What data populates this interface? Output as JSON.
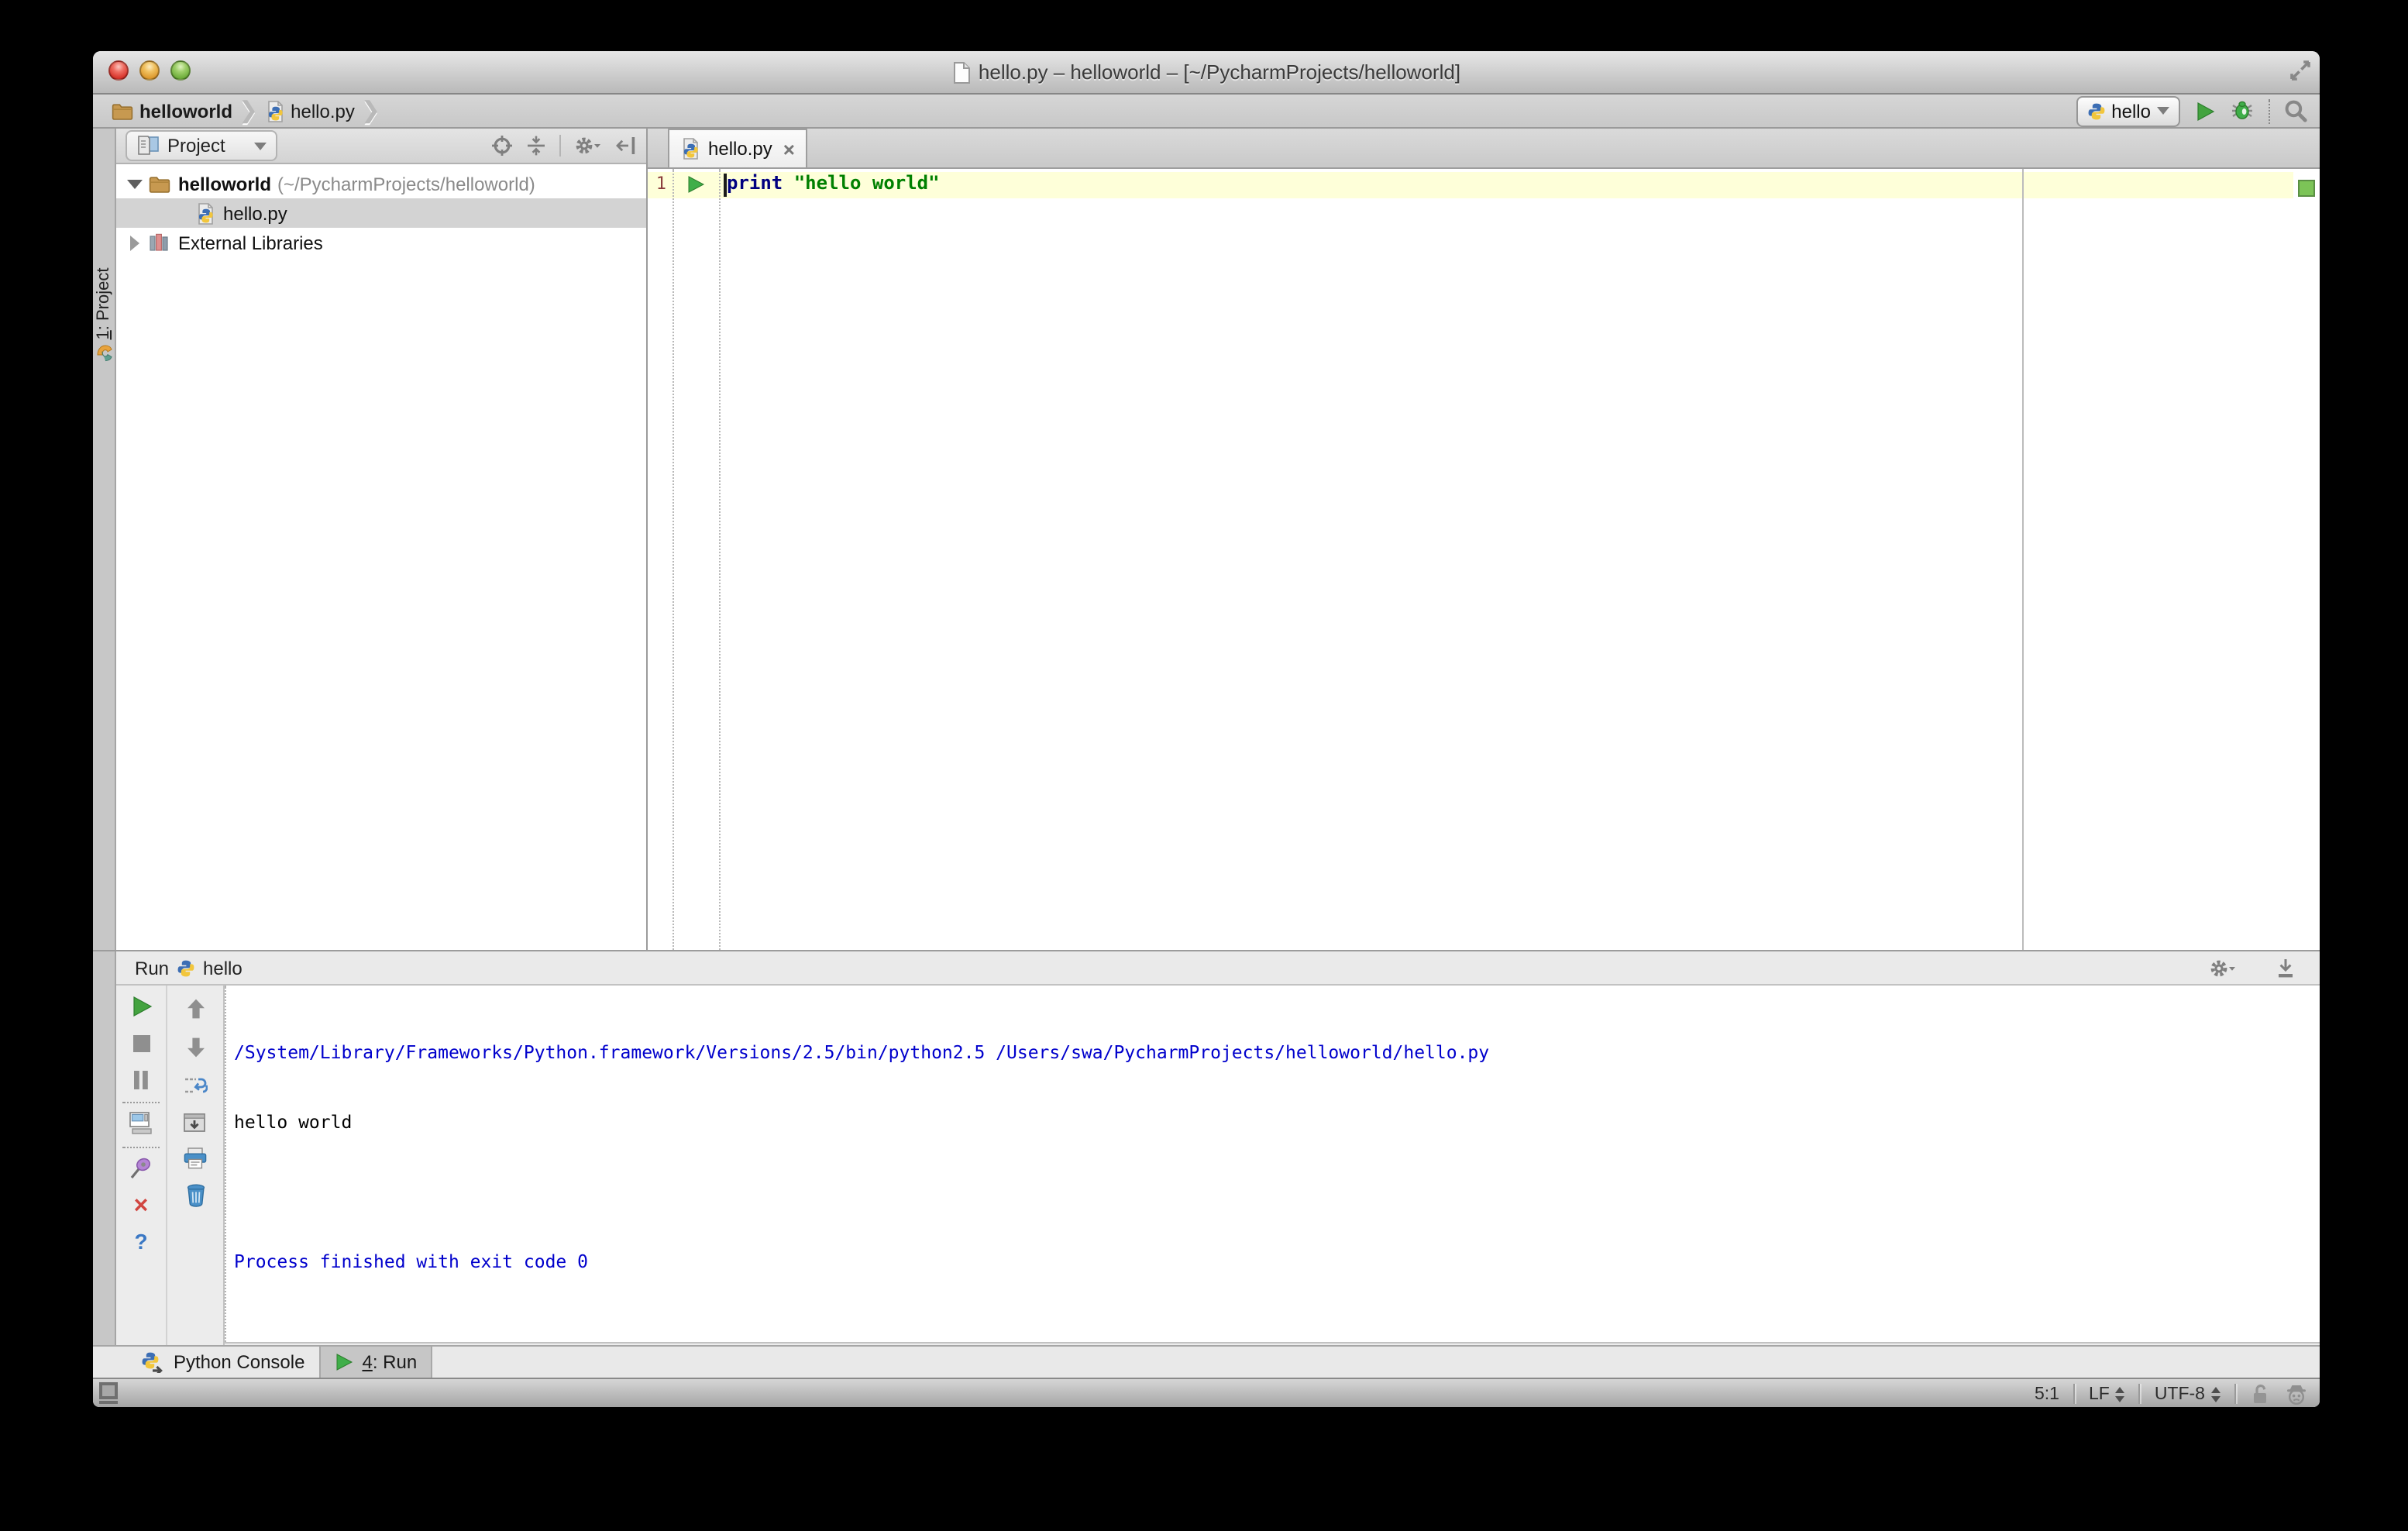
{
  "window": {
    "title": "hello.py – helloworld – [~/PycharmProjects/helloworld]"
  },
  "toolbar": {
    "breadcrumb": {
      "project": "helloworld",
      "file": "hello.py"
    },
    "run_config": "hello"
  },
  "stripe": {
    "number": "1",
    "label": ": Project"
  },
  "project_panel": {
    "header": "Project",
    "tree": {
      "root_name": "helloworld",
      "root_path": "(~/PycharmProjects/helloworld)",
      "file": "hello.py",
      "external": "External Libraries"
    }
  },
  "editor": {
    "tab": "hello.py",
    "line_number": "1",
    "code": {
      "keyword": "print",
      "string": "\"hello world\""
    }
  },
  "run_panel": {
    "title": "Run",
    "config": "hello",
    "console": [
      "/System/Library/Frameworks/Python.framework/Versions/2.5/bin/python2.5 /Users/swa/PycharmProjects/helloworld/hello.py",
      "hello world",
      "",
      "Process finished with exit code 0"
    ]
  },
  "bottom_bar": {
    "python_console": "Python Console",
    "run_number": "4",
    "run_label": ": Run"
  },
  "status_bar": {
    "caret": "5:1",
    "line_ending": "LF",
    "encoding": "UTF-8"
  },
  "icons": {
    "tab_close": "×",
    "close_console": "×",
    "help": "?",
    "breadcrumb_chevron": "❯",
    "inspection_status": "green-square",
    "run_marker": "green-triangle"
  },
  "colors": {
    "keyword": "#000080",
    "string": "#008000",
    "console_info": "#0000cc",
    "current_line": "#feffd9",
    "line_number": "#8a3b3b",
    "inspection_green": "#7cc457",
    "selection_gray": "#d3d3d3",
    "desktop": "#000000"
  }
}
